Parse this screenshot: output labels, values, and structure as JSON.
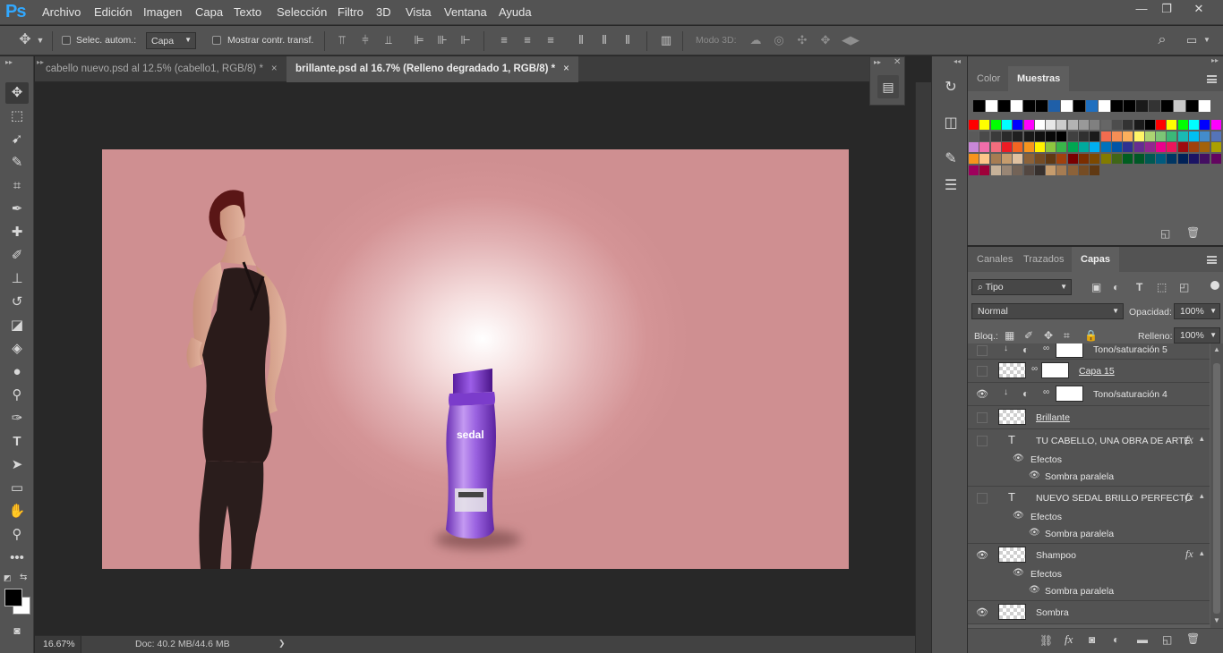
{
  "app": {
    "logo": "Ps"
  },
  "menu": [
    "Archivo",
    "Edición",
    "Imagen",
    "Capa",
    "Texto",
    "Selección",
    "Filtro",
    "3D",
    "Vista",
    "Ventana",
    "Ayuda"
  ],
  "window_controls": {
    "minimize": "—",
    "restore": "❐",
    "close": "✕"
  },
  "options": {
    "auto_select_label": "Selec. autom.:",
    "auto_select_target": "Capa",
    "show_transform_label": "Mostrar contr. transf.",
    "mode3d_label": "Modo 3D:"
  },
  "tabs": [
    {
      "label": "cabello nuevo.psd al 12.5% (cabello1, RGB/8) *",
      "active": false
    },
    {
      "label": "brillante.psd al 16.7% (Relleno degradado 1, RGB/8) *",
      "active": true
    }
  ],
  "tab_close": "×",
  "product": {
    "brand": "sedal"
  },
  "status": {
    "zoom": "16.67%",
    "doc": "Doc: 40.2 MB/44.6 MB",
    "arrow": "❯"
  },
  "swatch_panel": {
    "tabs": [
      "Color",
      "Muestras"
    ],
    "active_tab": "Muestras"
  },
  "swatches": {
    "row0": [
      "#000000",
      "#ffffff",
      "#000000",
      "#ffffff",
      "#000000",
      "#000000",
      "#1f5fa8",
      "#ffffff",
      "#000000",
      "#1f6fbf",
      "#ffffff",
      "#000000",
      "#000000",
      "#1a1a1a",
      "#333333",
      "#000000",
      "#c8c8c8",
      "#000000",
      "#ffffff"
    ],
    "rows": [
      [
        "#ff0000",
        "#ffff00",
        "#00ff00",
        "#00ffff",
        "#0000ff",
        "#ff00ff",
        "#ffffff",
        "#e6e6e6",
        "#cccccc",
        "#b3b3b3",
        "#999999",
        "#808080",
        "#666666",
        "#4d4d4d",
        "#333333",
        "#1a1a1a",
        "#000000",
        "#ff0000",
        "#ffff00",
        "#00ff00",
        "#00ffff",
        "#0000ff",
        "#ff00ff"
      ],
      [
        "#5a5a5a",
        "#4a4a4a",
        "#3a3a3a",
        "#2a2a2a",
        "#202020",
        "#181818",
        "#101010",
        "#080808",
        "#000000",
        "#404040",
        "#303030",
        "#1a1a1a",
        "#f26c4f",
        "#f68e55",
        "#fbaf5c",
        "#fff467",
        "#acd372",
        "#7cc576",
        "#3bb878",
        "#1abbb4",
        "#00bff3",
        "#438ccb",
        "#5574b9"
      ],
      [
        "#c987d7",
        "#f06eaa",
        "#f26d7d",
        "#ed1c24",
        "#f26522",
        "#f7941d",
        "#fff200",
        "#8dc63f",
        "#39b54a",
        "#00a651",
        "#00a99d",
        "#00aeef",
        "#0072bc",
        "#0054a6",
        "#2e3192",
        "#662d91",
        "#92278f",
        "#ec008c",
        "#ed145b",
        "#9e0b0f",
        "#a0410d",
        "#a3620a",
        "#aba000"
      ],
      [
        "#f7941d",
        "#fdc689",
        "#a67c52",
        "#c69c6d",
        "#e0c1a0",
        "#8c6239",
        "#754c24",
        "#603913",
        "#a1410d",
        "#790000",
        "#7b2e00",
        "#7d4900",
        "#827b00",
        "#406618",
        "#005e20",
        "#005826",
        "#005952",
        "#005b7f",
        "#003663",
        "#002157",
        "#1b1464",
        "#440e62",
        "#630460"
      ],
      [
        "#9e005d",
        "#9e0039",
        "#c7b299",
        "#998675",
        "#736357",
        "#534741",
        "#37302d",
        "#c69c6d",
        "#a67c52",
        "#8c6239",
        "#754c24",
        "#603913"
      ]
    ]
  },
  "layers_panel": {
    "tabs": [
      "Canales",
      "Trazados",
      "Capas"
    ],
    "active_tab": "Capas",
    "filter": "Tipo",
    "blend_mode": "Normal",
    "opacity_label": "Opacidad:",
    "opacity_value": "100%",
    "lock_label": "Bloq.:",
    "fill_label": "Relleno:",
    "fill_value": "100%",
    "layers": [
      {
        "name": "Tono/saturación 5",
        "visible": false
      },
      {
        "name": "Capa 15",
        "visible": false
      },
      {
        "name": "Tono/saturación 4",
        "visible": true
      },
      {
        "name": "Brillante",
        "visible": false
      },
      {
        "name": "TU CABELLO, UNA OBRA DE ARTE.",
        "visible": false,
        "fx": "fx",
        "effects": "Efectos",
        "effect": "Sombra paralela"
      },
      {
        "name": "NUEVO SEDAL BRILLO PERFECTO",
        "visible": false,
        "fx": "fx",
        "effects": "Efectos",
        "effect": "Sombra paralela"
      },
      {
        "name": "Shampoo",
        "visible": true,
        "fx": "fx",
        "effects": "Efectos",
        "effect": "Sombra paralela"
      },
      {
        "name": "Sombra",
        "visible": true
      }
    ]
  }
}
